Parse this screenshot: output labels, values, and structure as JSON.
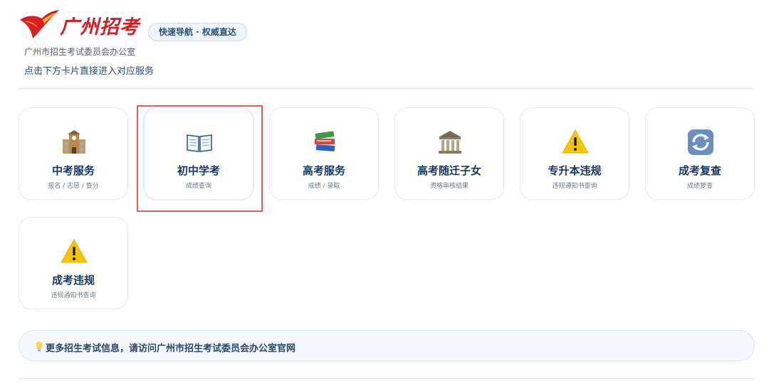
{
  "header": {
    "logo_text": "广州招考",
    "nav_pill": "快速导航 · 权威直达",
    "org_name": "广州市招生考试委员会办公室",
    "hint": "点击下方卡片直接进入对应服务"
  },
  "cards": [
    {
      "title": "中考服务",
      "subtitle": "报名 / 志愿 / 查分",
      "icon": "school-building-icon"
    },
    {
      "title": "初中学考",
      "subtitle": "成绩查询",
      "icon": "open-book-icon"
    },
    {
      "title": "高考服务",
      "subtitle": "成绩 / 录取",
      "icon": "stacked-books-icon"
    },
    {
      "title": "高考随迁子女",
      "subtitle": "资格审核结果",
      "icon": "classical-building-icon"
    },
    {
      "title": "专升本违规",
      "subtitle": "违规通知书查询",
      "icon": "warning-icon"
    },
    {
      "title": "成考复查",
      "subtitle": "成绩复查",
      "icon": "refresh-icon"
    },
    {
      "title": "成考违规",
      "subtitle": "违规通知书查询",
      "icon": "warning-icon"
    }
  ],
  "banner": {
    "text": "更多招生考试信息，请访问广州市招生考试委员会办公室官网",
    "icon": "lightbulb-icon"
  },
  "colors": {
    "brand_red": "#cf1f24",
    "title_navy": "#16365f",
    "highlight_red": "#e35b5b",
    "banner_bg": "#f4f8fd"
  }
}
